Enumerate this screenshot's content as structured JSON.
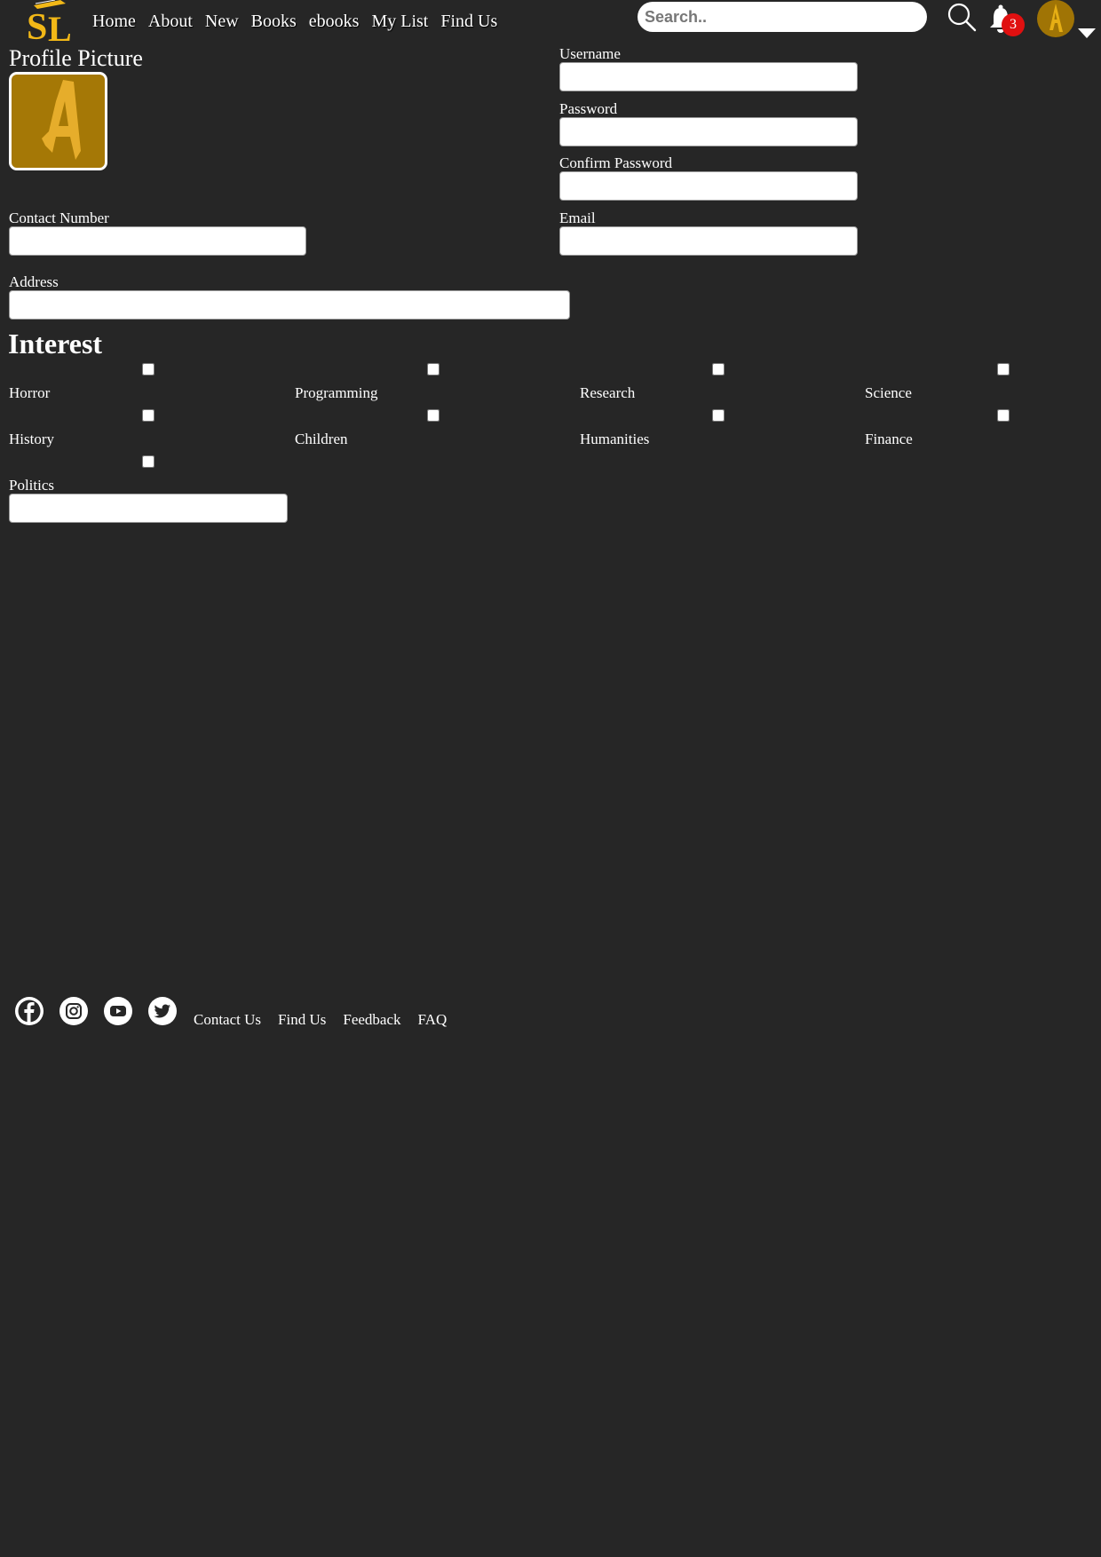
{
  "header": {
    "logo_icon": "sl-logo",
    "nav": [
      "Home",
      "About",
      "New",
      "Books",
      "ebooks",
      "My List",
      "Find Us"
    ],
    "search_placeholder": "Search..",
    "search_icon": "search-icon",
    "notification_icon": "bell-icon",
    "notification_count": "3",
    "avatar_icon": "letter-a-avatar",
    "menu_icon": "caret-down-icon"
  },
  "form": {
    "profile_picture_label": "Profile Picture",
    "username_label": "Username",
    "username_value": "",
    "password_label": "Password",
    "password_value": "",
    "confirm_password_label": "Confirm Password",
    "confirm_password_value": "",
    "contact_label": "Contact Number",
    "contact_value": "",
    "email_label": "Email",
    "email_value": "",
    "address_label": "Address",
    "address_value": ""
  },
  "interest": {
    "title": "Interest",
    "options": [
      "Horror",
      "Programming",
      "Research",
      "Science",
      "History",
      "Children",
      "Humanities",
      "Finance",
      "Politics"
    ],
    "checked": [
      false,
      false,
      false,
      false,
      false,
      false,
      false,
      false,
      false
    ]
  },
  "footer": {
    "social": [
      "facebook-icon",
      "instagram-icon",
      "youtube-icon",
      "twitter-icon"
    ],
    "links": [
      "Contact Us",
      "Find Us",
      "Feedback",
      "FAQ"
    ]
  },
  "colors": {
    "background": "#262626",
    "accent_gold": "#a57806",
    "logo_yellow": "#f2b817",
    "badge_red": "#e01010"
  }
}
